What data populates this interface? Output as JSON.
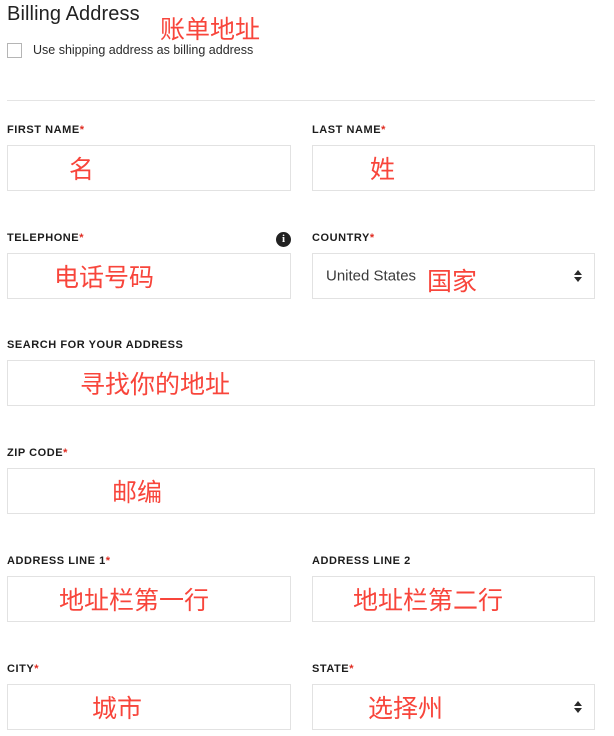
{
  "section": {
    "title": "Billing Address",
    "title_annotation": "账单地址"
  },
  "checkbox": {
    "label": "Use shipping address as billing address",
    "checked": false
  },
  "colors": {
    "annotation_red": "#f8453b",
    "required_red": "#e02b20",
    "input_border": "#e2e2e2",
    "divider": "#e4e4e4",
    "text": "#1a1a1a"
  },
  "fields": [
    {
      "name": "first-name",
      "label": "FIRST NAME",
      "required": true,
      "type": "text",
      "value": "",
      "annotation": "名"
    },
    {
      "name": "last-name",
      "label": "LAST NAME",
      "required": true,
      "type": "text",
      "value": "",
      "annotation": "姓"
    },
    {
      "name": "telephone",
      "label": "TELEPHONE",
      "required": true,
      "type": "text",
      "value": "",
      "annotation": "电话号码",
      "has_info_icon": true
    },
    {
      "name": "country",
      "label": "COUNTRY",
      "required": true,
      "type": "select",
      "value": "United States",
      "annotation": "国家"
    },
    {
      "name": "search-for-your-address",
      "label": "SEARCH FOR YOUR ADDRESS",
      "required": false,
      "type": "text",
      "value": "",
      "annotation": "寻找你的地址"
    },
    {
      "name": "zip-code",
      "label": "ZIP CODE",
      "required": true,
      "type": "text",
      "value": "",
      "annotation": "邮编"
    },
    {
      "name": "address-line-1",
      "label": "ADDRESS LINE 1",
      "required": true,
      "type": "text",
      "value": "",
      "annotation": "地址栏第一行"
    },
    {
      "name": "address-line-2",
      "label": "ADDRESS LINE 2",
      "required": false,
      "type": "text",
      "value": "",
      "annotation": "地址栏第二行"
    },
    {
      "name": "city",
      "label": "CITY",
      "required": true,
      "type": "text",
      "value": "",
      "annotation": "城市"
    },
    {
      "name": "state",
      "label": "STATE",
      "required": true,
      "type": "select",
      "value": "",
      "annotation": "选择州"
    }
  ],
  "icons": {
    "info": "i"
  }
}
